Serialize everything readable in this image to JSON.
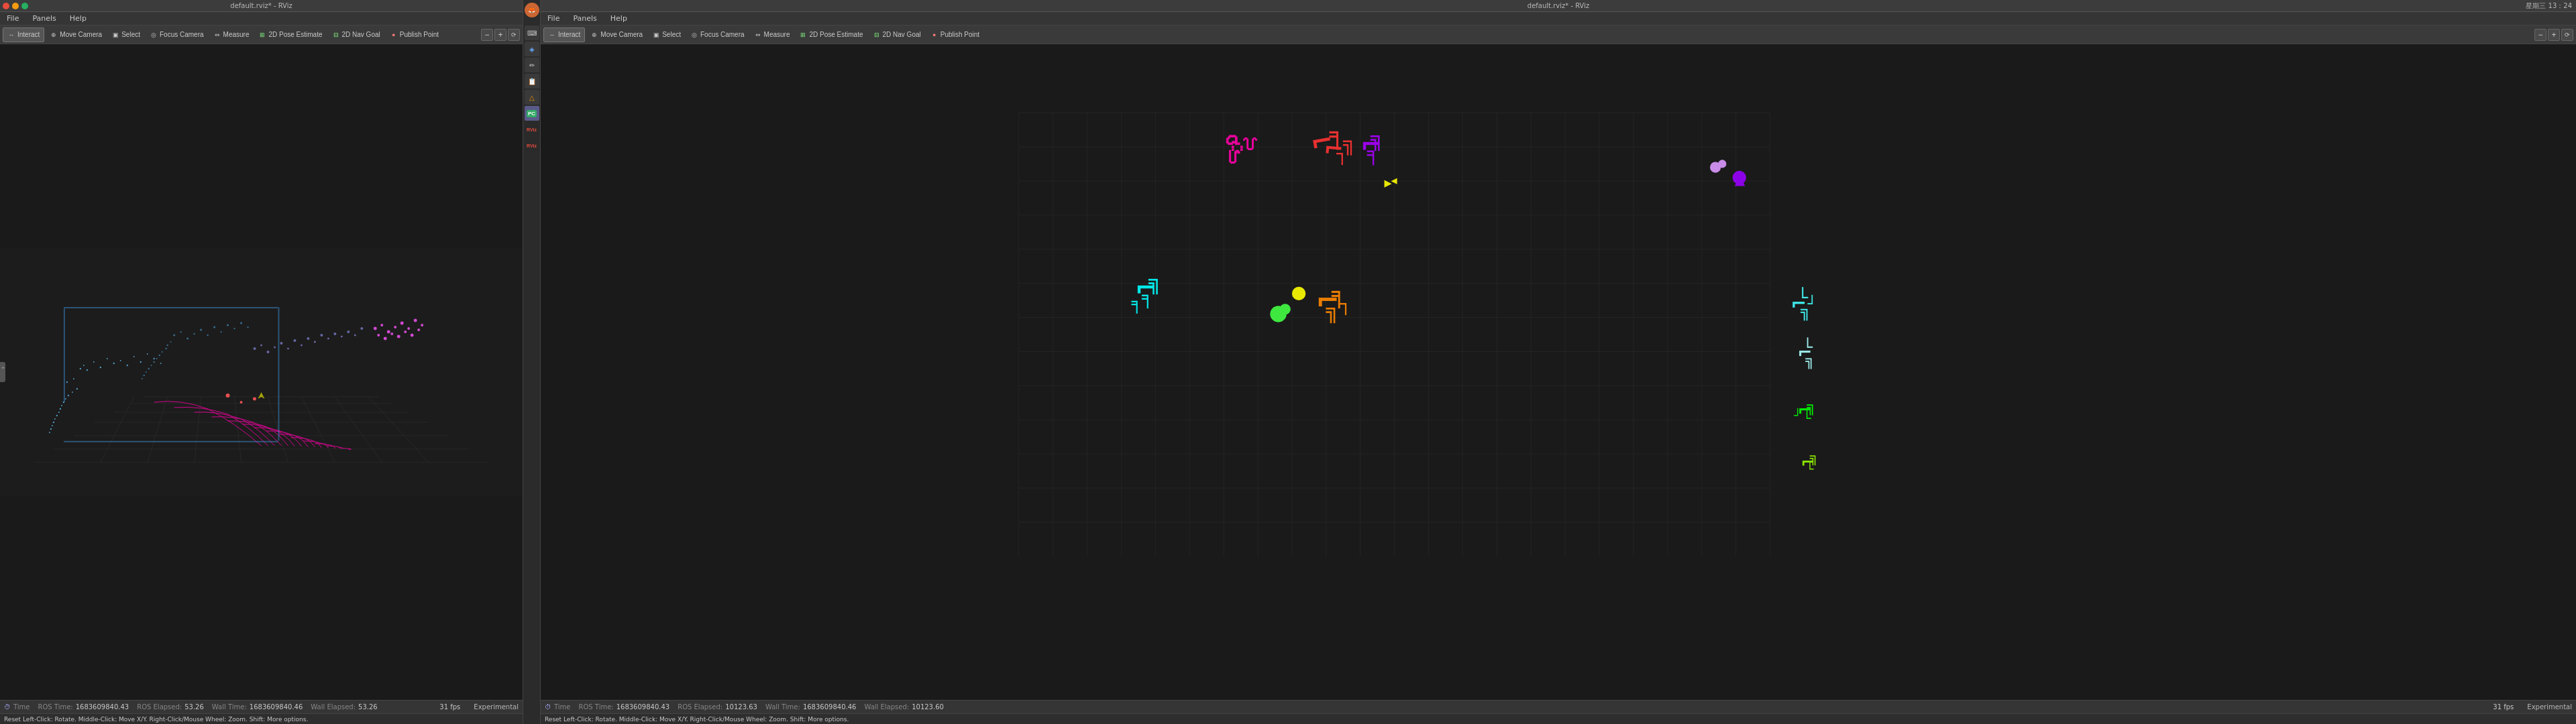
{
  "left_window": {
    "title": "default.rviz* - RViz",
    "menu": {
      "file": "File",
      "panels": "Panels",
      "help": "Help"
    },
    "toolbar": {
      "interact": "Interact",
      "move_camera": "Move Camera",
      "select": "Select",
      "focus_camera": "Focus Camera",
      "measure": "Measure",
      "pose_estimate": "2D Pose Estimate",
      "nav_goal": "2D Nav Goal",
      "publish_point": "Publish Point"
    },
    "status": {
      "time_label": "Time",
      "ros_time_label": "ROS Time:",
      "ros_time_value": "1683609840.43",
      "ros_elapsed_label": "ROS Elapsed:",
      "ros_elapsed_value": "53.26",
      "wall_time_label": "Wall Time:",
      "wall_time_value": "1683609840.46",
      "wall_elapsed_label": "Wall Elapsed:",
      "wall_elapsed_value": "53.26",
      "fps": "31 fps",
      "experimental": "Experimental"
    },
    "hint": "Reset   Left-Click: Rotate.  Middle-Click: Move X/Y.  Right-Click/Mouse Wheel: Zoom.  Shift:  More options."
  },
  "right_window": {
    "title": "default.rviz* - RViz",
    "datetime": "星期三 13：24",
    "menu": {
      "file": "File",
      "panels": "Panels",
      "help": "Help"
    },
    "toolbar": {
      "interact": "Interact",
      "move_camera": "Move Camera",
      "select": "Select",
      "focus_camera": "Focus Camera",
      "measure": "Measure",
      "pose_estimate": "2D Pose Estimate",
      "nav_goal": "2D Nav Goal",
      "publish_point": "Publish Point"
    },
    "status": {
      "time_label": "Time",
      "ros_time_label": "ROS Time:",
      "ros_time_value": "1683609840.43",
      "ros_elapsed_label": "ROS Elapsed:",
      "ros_elapsed_value": "10123.63",
      "wall_time_label": "Wall Time:",
      "wall_time_value": "1683609840.46",
      "wall_elapsed_label": "Wall Elapsed:",
      "wall_elapsed_value": "10123.60",
      "fps": "31 fps",
      "experimental": "Experimental"
    },
    "hint": "Reset   Left-Click: Rotate.  Middle-Click: Move X/Y.  Right-Click/Mouse Wheel: Zoom.  Shift:  More options."
  },
  "sidebar": {
    "icons": [
      {
        "name": "terminal-icon",
        "symbol": "⌨",
        "active": false
      },
      {
        "name": "git-icon",
        "symbol": "◈",
        "active": false
      },
      {
        "name": "edit-icon",
        "symbol": "✏",
        "active": false
      },
      {
        "name": "doc-icon",
        "symbol": "📄",
        "active": false
      },
      {
        "name": "chart-icon",
        "symbol": "△",
        "active": false
      },
      {
        "name": "pc-icon",
        "symbol": "PC",
        "active": true
      },
      {
        "name": "rviz1-icon",
        "symbol": "RViz",
        "active": false
      },
      {
        "name": "rviz2-icon",
        "symbol": "RViz",
        "active": false
      }
    ]
  }
}
